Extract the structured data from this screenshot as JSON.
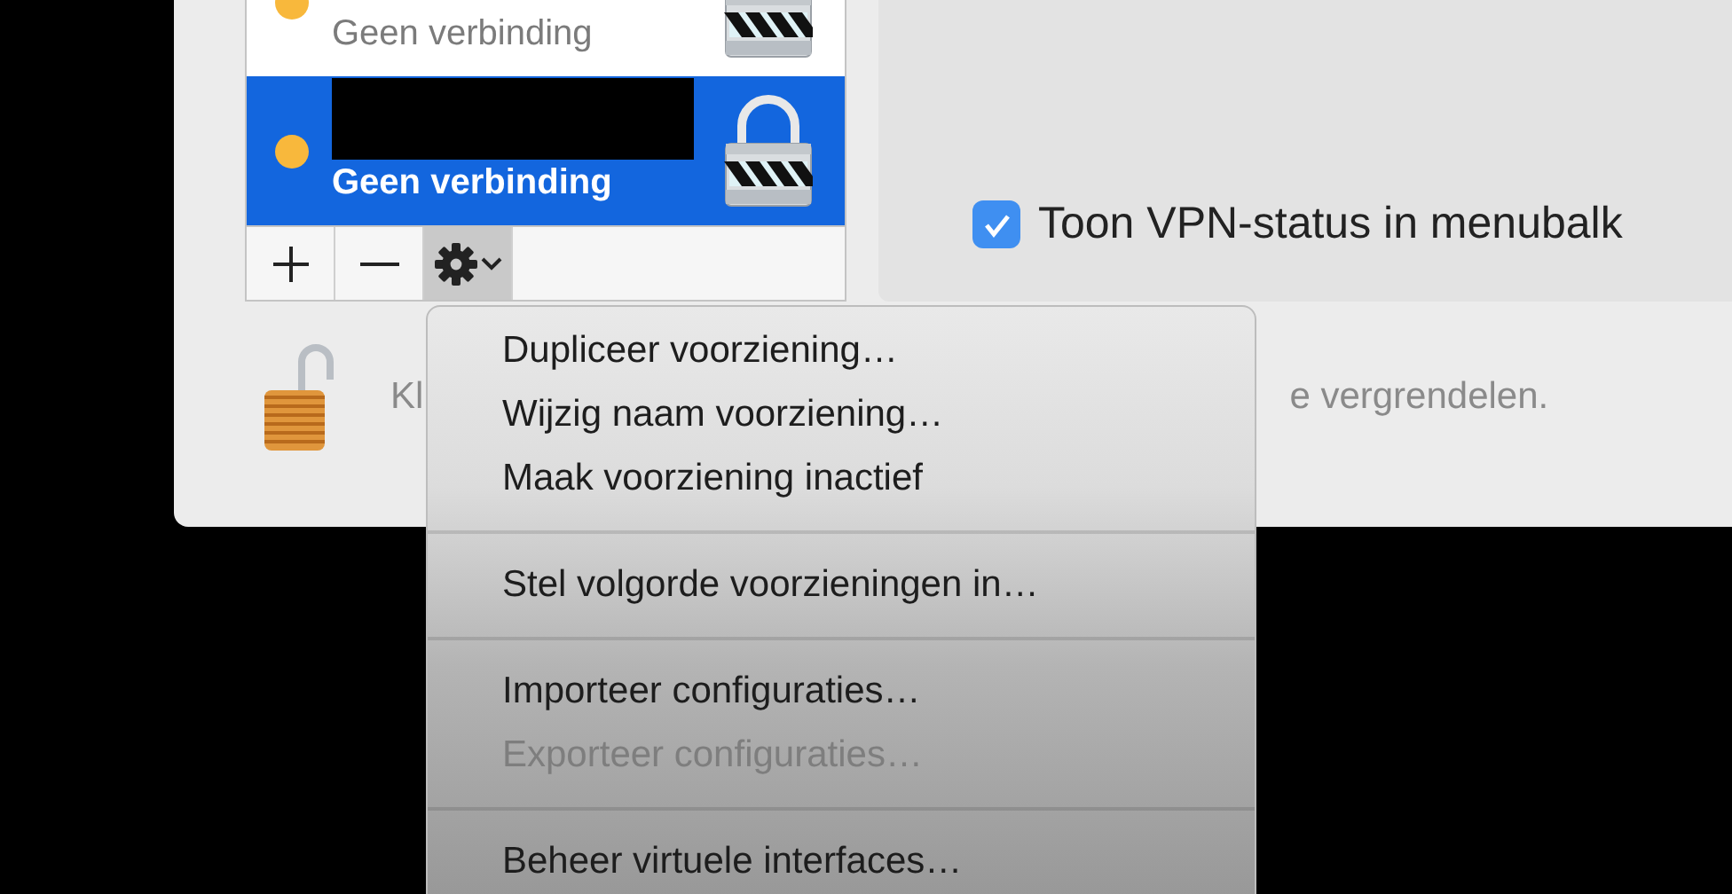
{
  "services": [
    {
      "status": "Geen verbinding",
      "selected": false,
      "redacted": false,
      "color": "#f8b83c"
    },
    {
      "status": "Geen verbinding",
      "selected": true,
      "redacted": true,
      "color": "#f8b83c"
    }
  ],
  "toolbar": [
    {
      "kind": "add",
      "pressed": false
    },
    {
      "kind": "remove",
      "pressed": false
    },
    {
      "kind": "gear",
      "pressed": true
    }
  ],
  "show_vpn_status": {
    "label": "Toon VPN-status in menubalk",
    "checked": true
  },
  "lock_text": {
    "before_menu": "Kl",
    "after_menu": "e vergrendelen."
  },
  "menu": {
    "items": [
      {
        "kind": "item",
        "label": "Dupliceer voorziening…",
        "disabled": false
      },
      {
        "kind": "item",
        "label": "Wijzig naam voorziening…",
        "disabled": false
      },
      {
        "kind": "item",
        "label": "Maak voorziening inactief",
        "disabled": false
      },
      {
        "kind": "separator"
      },
      {
        "kind": "item",
        "label": "Stel volgorde voorzieningen in…",
        "disabled": false
      },
      {
        "kind": "separator"
      },
      {
        "kind": "item",
        "label": "Importeer configuraties…",
        "disabled": false
      },
      {
        "kind": "item",
        "label": "Exporteer configuraties…",
        "disabled": true
      },
      {
        "kind": "separator"
      },
      {
        "kind": "item",
        "label": "Beheer virtuele interfaces…",
        "disabled": false
      }
    ]
  }
}
